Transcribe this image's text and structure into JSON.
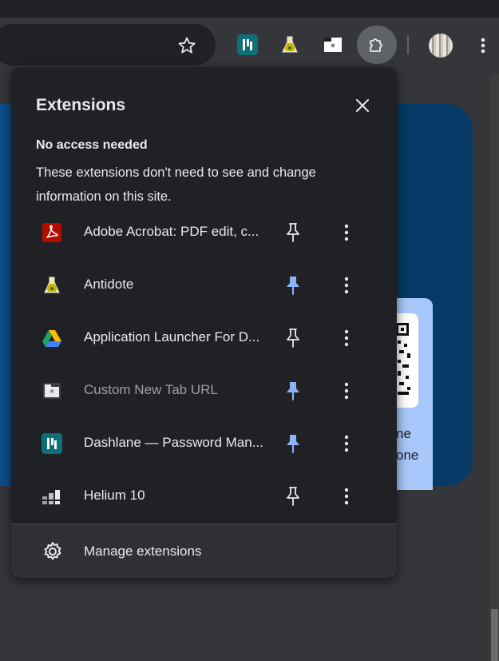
{
  "popup": {
    "title": "Extensions",
    "section_heading": "No access needed",
    "section_description": "These extensions don't need to see and change information on this site.",
    "manage_label": "Manage extensions"
  },
  "extensions": [
    {
      "name": "Adobe Acrobat: PDF edit, c...",
      "icon": "adobe-acrobat-icon",
      "pinned": false,
      "dimmed": false
    },
    {
      "name": "Antidote",
      "icon": "antidote-flask-icon",
      "pinned": true,
      "dimmed": false
    },
    {
      "name": "Application Launcher For D...",
      "icon": "google-drive-icon",
      "pinned": false,
      "dimmed": false
    },
    {
      "name": "Custom New Tab URL",
      "icon": "custom-new-tab-icon",
      "pinned": true,
      "dimmed": true
    },
    {
      "name": "Dashlane — Password Man...",
      "icon": "dashlane-icon",
      "pinned": true,
      "dimmed": false
    },
    {
      "name": "Helium 10",
      "icon": "helium10-icon",
      "pinned": false,
      "dimmed": false
    }
  ],
  "page_behind": {
    "card_line_1": "ne",
    "card_line_2": "one"
  },
  "colors": {
    "popup_bg": "#202124",
    "pinned_blue": "#8ab4f8",
    "text": "#e8eaed",
    "dim_text": "#9aa0a6"
  }
}
